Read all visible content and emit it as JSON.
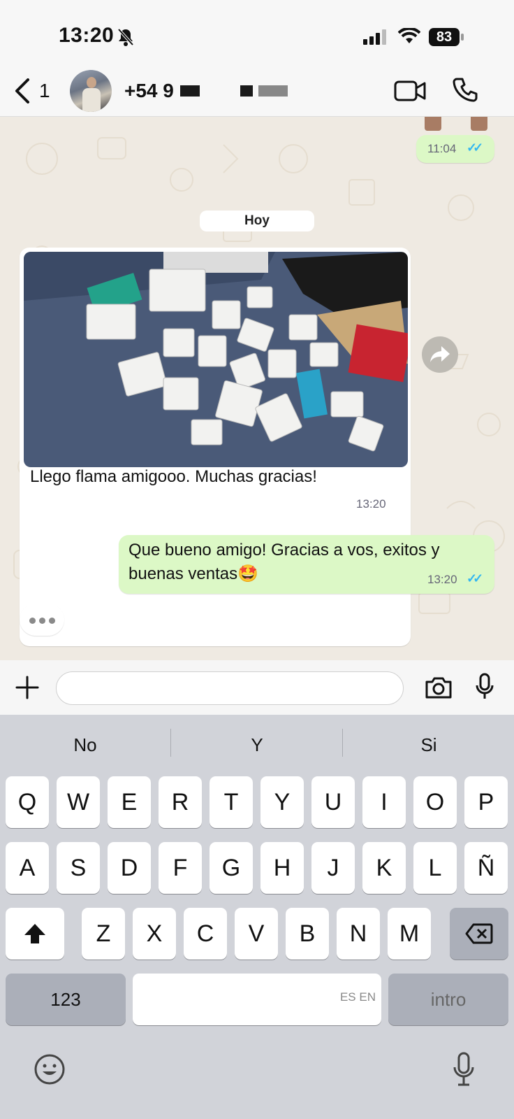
{
  "status": {
    "time": "13:20",
    "battery": "83"
  },
  "header": {
    "back_count": "1",
    "contact": "+54 9"
  },
  "chat": {
    "earlier_time": "11:04",
    "day_label": "Hoy",
    "incoming": {
      "text": "Llego flama amigooo. Muchas gracias!",
      "time": "13:20"
    },
    "outgoing": {
      "text_line1": "Que bueno amigo! Gracias a vos, exitos y",
      "text_line2": "buenas ventas",
      "emoji": "🤩",
      "time": "13:20"
    }
  },
  "input": {
    "value": ""
  },
  "keyboard": {
    "suggestions": [
      "No",
      "Y",
      "Si"
    ],
    "row1": [
      "Q",
      "W",
      "E",
      "R",
      "T",
      "Y",
      "U",
      "I",
      "O",
      "P"
    ],
    "row2": [
      "A",
      "S",
      "D",
      "F",
      "G",
      "H",
      "J",
      "K",
      "L",
      "Ñ"
    ],
    "row3": [
      "Z",
      "X",
      "C",
      "V",
      "B",
      "N",
      "M"
    ],
    "numbers_label": "123",
    "space_lang": "ES EN",
    "return_label": "intro"
  },
  "colors": {
    "outgoing_bubble": "#dcf8c6",
    "read_ticks": "#34b7f1",
    "chat_bg": "#efeae2"
  }
}
